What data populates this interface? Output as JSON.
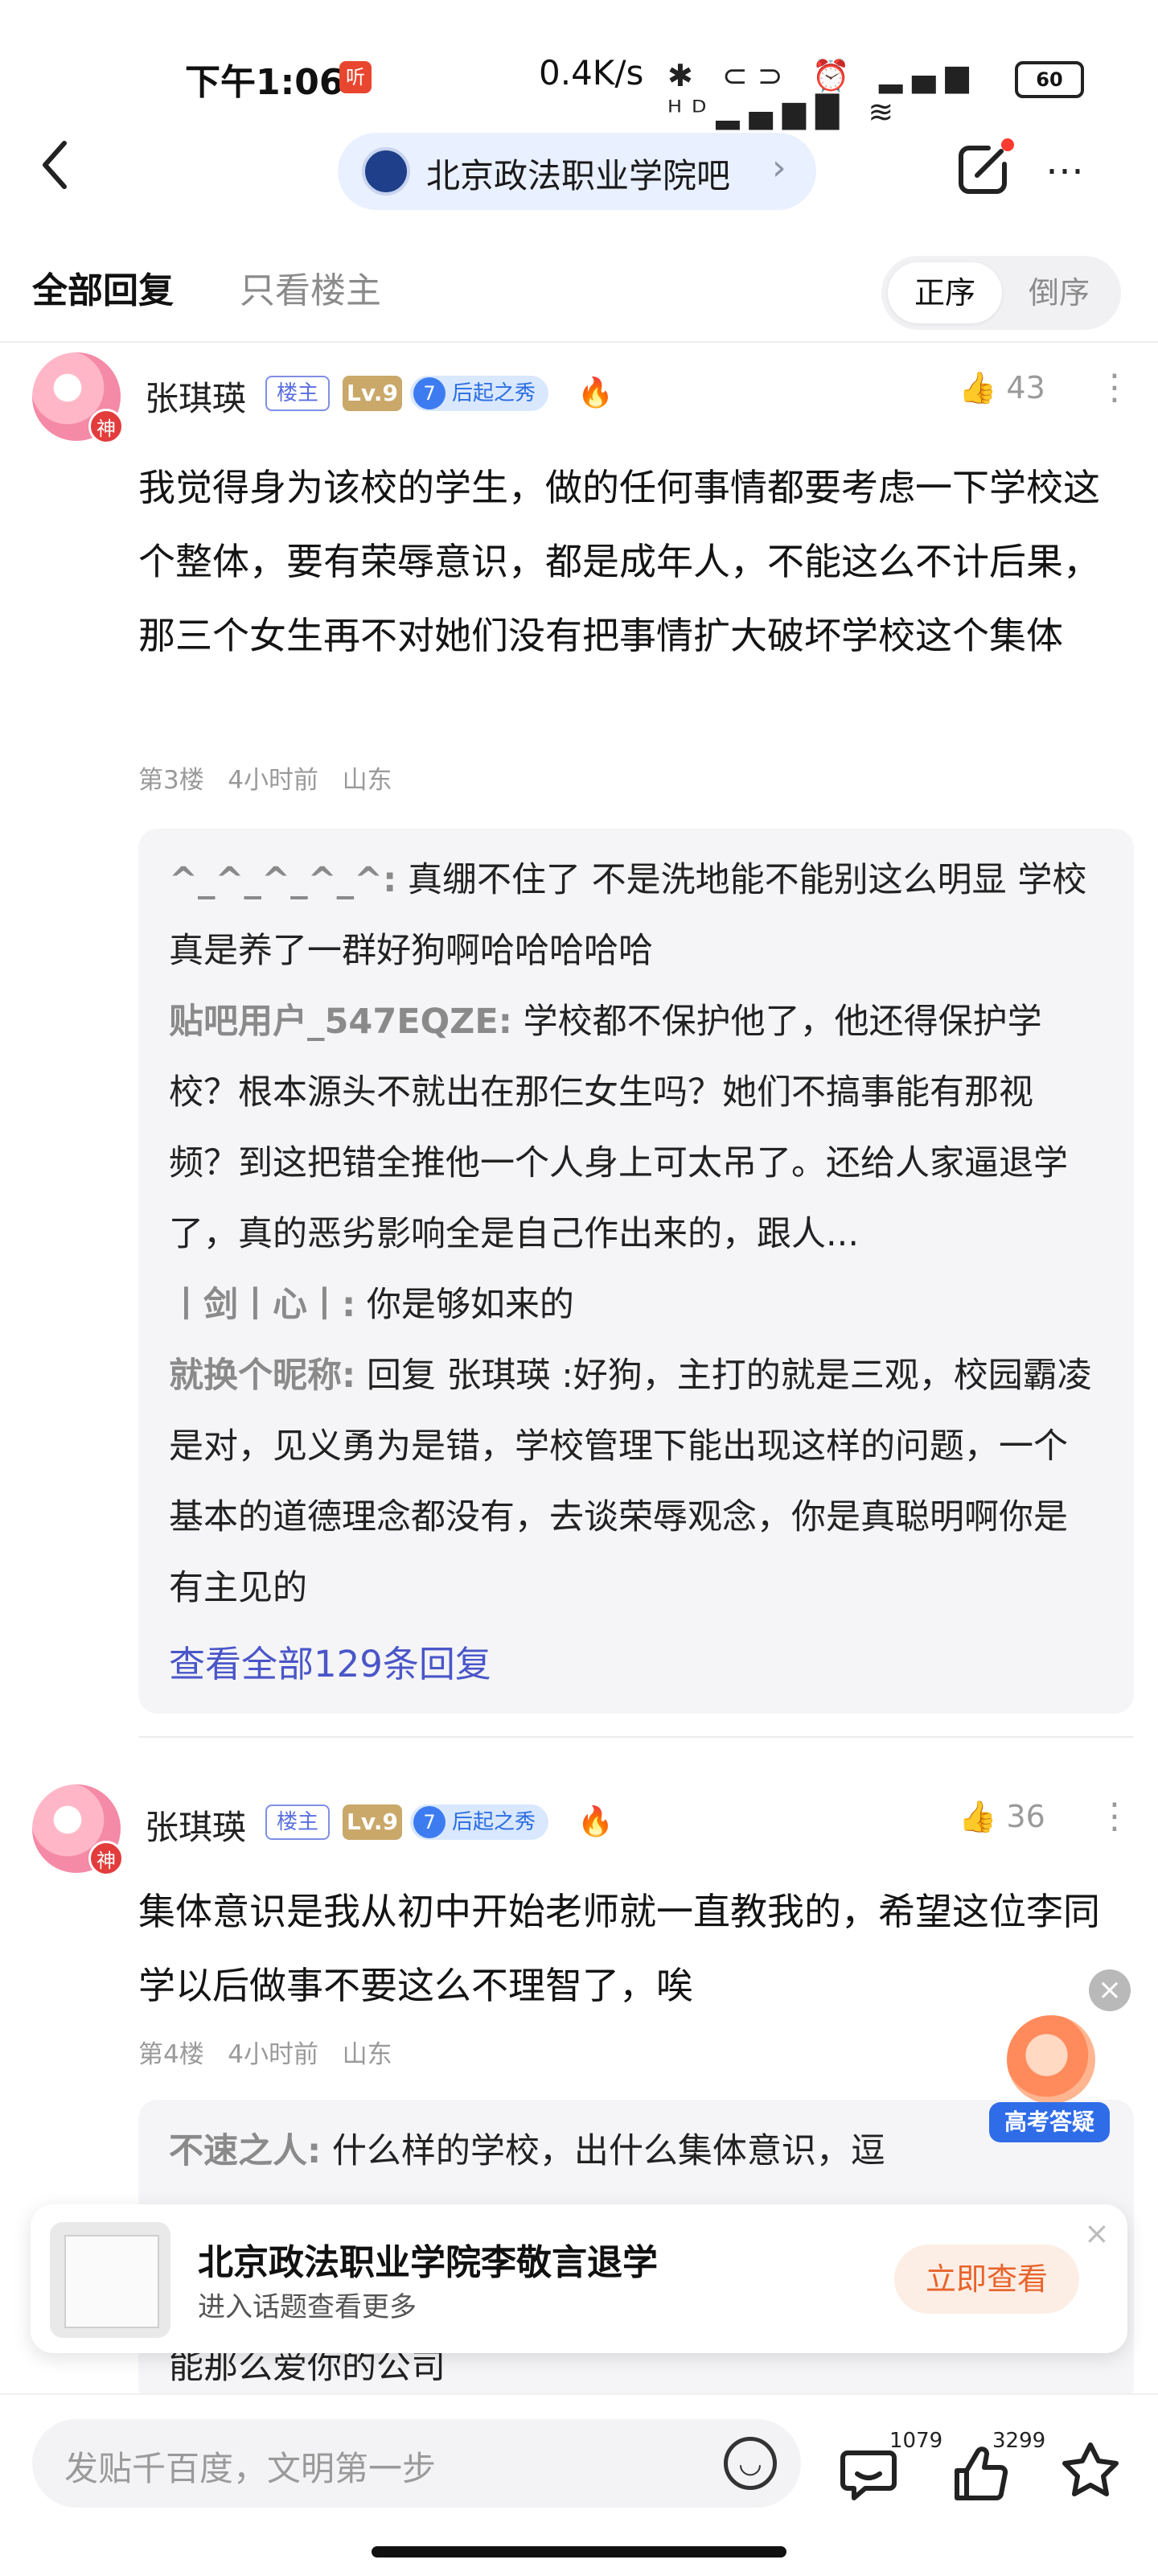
{
  "status_bar": {
    "time": "下午1:06",
    "listen_badge": "听",
    "net_speed": "0.4K/s",
    "icons_text": "✱ ⊂⊃ ⏰ ▂▄▆ ᴴᴰ▂▄▆█ ≋",
    "battery": "60"
  },
  "nav": {
    "back_icon": "chevron-left",
    "forum_name": "北京政法职业学院吧",
    "forum_arrow": "›",
    "more": "⋯"
  },
  "tabs": {
    "all_replies": "全部回复",
    "only_op": "只看楼主",
    "sort_asc": "正序",
    "sort_desc": "倒序"
  },
  "posts": [
    {
      "avatar_badge": "神",
      "username": "张琪瑛",
      "op_badge": "楼主",
      "level": "Lv.9",
      "rise_num": "7",
      "rise_label": "后起之秀",
      "likes": "43",
      "content": "我觉得身为该校的学生，做的任何事情都要考虑一下学校这个整体，要有荣辱意识，都是成年人，不能这么不计后果，那三个女生再不对她们没有把事情扩大破坏学校这个集体",
      "floor": "第3楼",
      "time": "4小时前",
      "location": "山东",
      "replies": [
        {
          "who": "^_^_^_^_^:",
          "text": " 真绷不住了 不是洗地能不能别这么明显 学校真是养了一群好狗啊哈哈哈哈哈"
        },
        {
          "who": "贴吧用户_547EQZE:",
          "text": " 学校都不保护他了，他还得保护学校？根本源头不就出在那仨女生吗？她们不搞事能有那视频？到这把错全推他一个人身上可太吊了。还给人家逼退学了，真的恶劣影响全是自己作出来的，跟人..."
        },
        {
          "who": "丨剑丨心丨:",
          "text": " 你是够如来的"
        },
        {
          "who": "就换个昵称:",
          "text": " 回复 张琪瑛 :好狗，主打的就是三观，校园霸凌是对，见义勇为是错，学校管理下能出现这样的问题，一个基本的道德理念都没有，去谈荣辱观念，你是真聪明啊你是有主见的"
        }
      ],
      "view_all": "查看全部129条回复"
    },
    {
      "avatar_badge": "神",
      "username": "张琪瑛",
      "op_badge": "楼主",
      "level": "Lv.9",
      "rise_num": "7",
      "rise_label": "后起之秀",
      "likes": "36",
      "content": "集体意识是我从初中开始老师就一直教我的，希望这位李同学以后做事不要这么不理智了，唉",
      "floor": "第4楼",
      "time": "4小时前",
      "location": "山东",
      "replies": [
        {
          "who": "不速之人:",
          "text": " 什么样的学校，出什么集体意识，逗"
        }
      ],
      "partial_reply_tail": "能那么爱你的公司"
    }
  ],
  "floating": {
    "close": "×",
    "promo_label": "高考答疑"
  },
  "topic_card": {
    "title": "北京政法职业学院李敬言退学",
    "subtitle": "进入话题查看更多",
    "button": "立即查看",
    "close": "×"
  },
  "bottom_bar": {
    "input_placeholder": "发贴千百度，文明第一步",
    "comment_count": "1079",
    "like_count": "3299"
  }
}
